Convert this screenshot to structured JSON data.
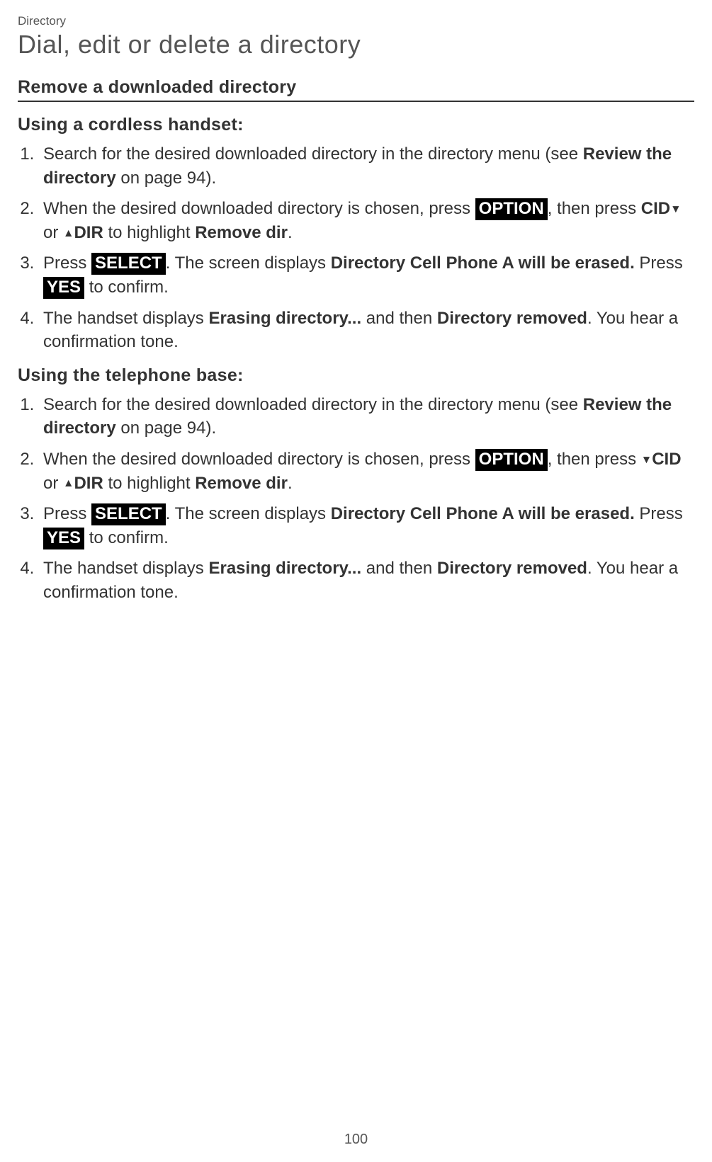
{
  "chapter": "Directory",
  "title": "Dial, edit or delete a directory",
  "section_heading": "Remove a downloaded directory",
  "handset": {
    "heading": "Using a cordless handset:",
    "steps": {
      "s1_a": "Search for the desired downloaded directory in the directory menu (see ",
      "s1_b": "Review the directory",
      "s1_c": " on page 94).",
      "s2_a": "When the desired downloaded directory is chosen, press ",
      "s2_option": "OPTION",
      "s2_b": ", then press ",
      "s2_cid": "CID",
      "s2_c": " or ",
      "s2_dir": "DIR",
      "s2_d": " to highlight ",
      "s2_remove": "Remove dir",
      "s2_e": ".",
      "s3_a": "Press ",
      "s3_select": "SELECT",
      "s3_b": ". The screen displays ",
      "s3_msg": "Directory Cell Phone A will be erased.",
      "s3_c": " Press ",
      "s3_yes": "YES",
      "s3_d": " to confirm.",
      "s4_a": "The handset displays ",
      "s4_erasing": "Erasing directory...",
      "s4_b": " and then ",
      "s4_removed": "Directory removed",
      "s4_c": ". You hear a confirmation tone."
    }
  },
  "base": {
    "heading": "Using the telephone base:",
    "steps": {
      "s1_a": "Search for the desired downloaded directory in the directory menu (see ",
      "s1_b": "Review the directory",
      "s1_c": " on page 94).",
      "s2_a": "When the desired downloaded directory is chosen, press ",
      "s2_option": "OPTION",
      "s2_b": ", then press ",
      "s2_cid": "CID",
      "s2_c": " or ",
      "s2_dir": "DIR",
      "s2_d": " to highlight ",
      "s2_remove": "Remove dir",
      "s2_e": ".",
      "s3_a": "Press ",
      "s3_select": "SELECT",
      "s3_b": ". The screen displays ",
      "s3_msg": "Directory Cell Phone A will be erased.",
      "s3_c": " Press ",
      "s3_yes": "YES",
      "s3_d": " to confirm.",
      "s4_a": "The handset displays ",
      "s4_erasing": "Erasing directory...",
      "s4_b": " and then ",
      "s4_removed": "Directory removed",
      "s4_c": ". You hear a confirmation tone."
    }
  },
  "page_number": "100"
}
